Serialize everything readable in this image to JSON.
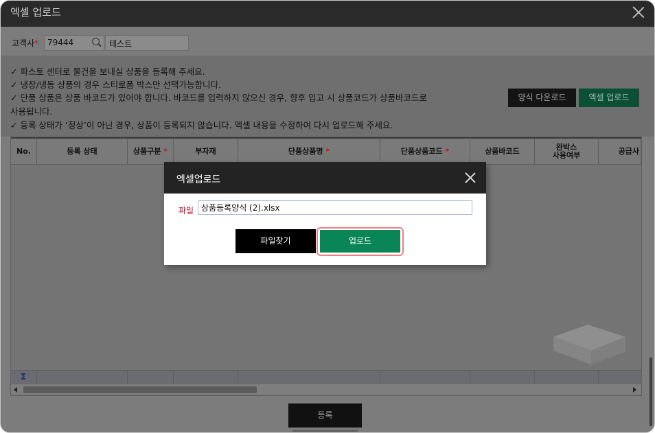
{
  "window": {
    "title": "엑셀 업로드"
  },
  "client": {
    "label": "고객사",
    "required_mark": "*",
    "code": "79444",
    "name": "테스트"
  },
  "notices": [
    "✓ 파스토 센터로 물건을 보내실 상품을 등록해 주세요.",
    "✓ 냉장/냉동 상품의 경우 스티로폼 박스만 선택가능합니다.",
    "✓ 단품 상품은 상품 바코드가 있어야 합니다. 바코드를 입력하지 않으신 경우, 향후 입고 시 상품코드가 상품바코드로",
    "사용됩니다.",
    "✓ 등록 상태가 ‘정상’이 아닌 경우, 상품이 등록되지 않습니다. 엑셀 내용을 수정하여 다시 업로드해 주세요."
  ],
  "actions": {
    "template_download": "양식 다운로드",
    "excel_upload": "엑셀 업로드"
  },
  "grid": {
    "columns": [
      {
        "label": "No.",
        "required": false
      },
      {
        "label": "등록 상태",
        "required": false
      },
      {
        "label": "상품구분",
        "required": true
      },
      {
        "label": "부자재",
        "required": false
      },
      {
        "label": "단품상품명",
        "required": true
      },
      {
        "label": "단품상품코드",
        "required": true
      },
      {
        "label": "상품바코드",
        "required": false
      },
      {
        "label": "완박스\n사용여부",
        "required": false
      },
      {
        "label": "공급사",
        "required": false
      }
    ],
    "sum_symbol": "Σ"
  },
  "modal": {
    "title": "엑셀업로드",
    "file_label": "파일",
    "file_value": "상품등록양식 (2).xlsx",
    "find_button": "파일찾기",
    "upload_button": "업로드"
  },
  "footer": {
    "register_button": "등록"
  },
  "colors": {
    "upload_green": "#0a8558",
    "required_red": "#c0132d",
    "dark_header": "#232323"
  }
}
